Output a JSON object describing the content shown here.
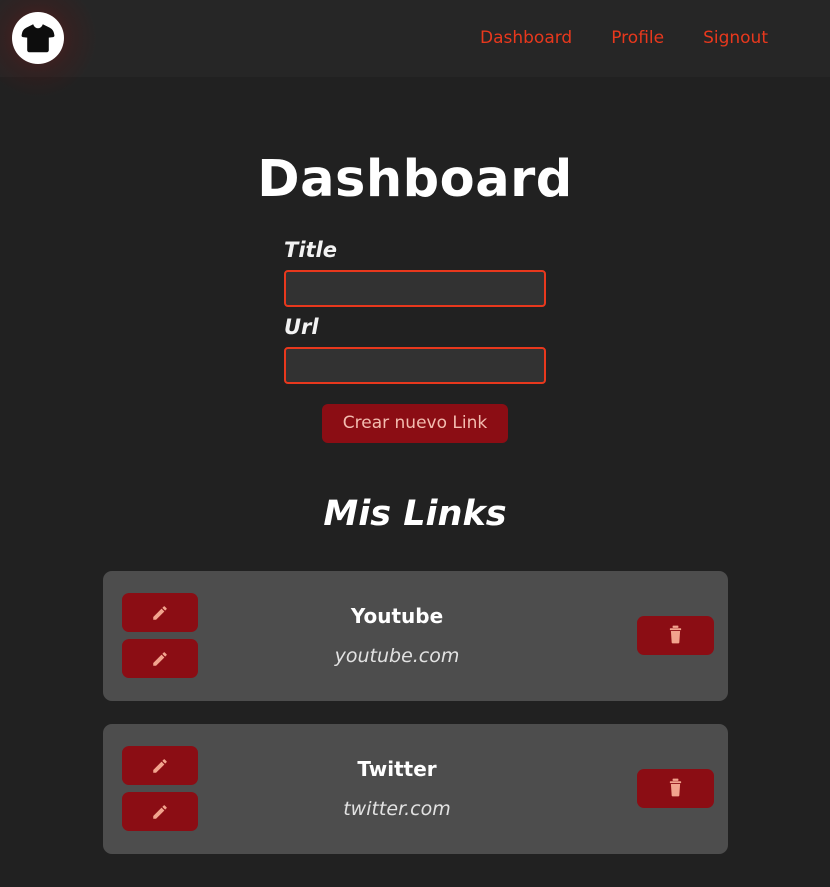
{
  "navbar": {
    "logo": {
      "icon": "tshirt-icon",
      "shape": "white-circle"
    },
    "links": [
      {
        "label": "Dashboard",
        "name": "nav-link-dashboard"
      },
      {
        "label": "Profile",
        "name": "nav-link-profile"
      },
      {
        "label": "Signout",
        "name": "nav-link-signout"
      }
    ]
  },
  "page": {
    "title": "Dashboard",
    "section_title": "Mis Links"
  },
  "form": {
    "title_label": "Title",
    "title_value": "",
    "title_placeholder": "",
    "url_label": "Url",
    "url_value": "",
    "url_placeholder": "",
    "submit_label": "Crear nuevo Link"
  },
  "links": [
    {
      "title": "Youtube",
      "url": "youtube.com",
      "edit_icon": "pencil-icon",
      "delete_icon": "trash-icon"
    },
    {
      "title": "Twitter",
      "url": "twitter.com",
      "edit_icon": "pencil-icon",
      "delete_icon": "trash-icon"
    }
  ],
  "colors": {
    "page_background": "#212121",
    "navbar_background": "#262626",
    "accent_red": "#e8381d",
    "button_dark_red": "#8b0d14",
    "button_text": "#f3bcb0",
    "card_background": "#4d4d4d",
    "icon_salmon": "#f2a48e",
    "input_background": "#323232",
    "text_white": "#ffffff"
  }
}
